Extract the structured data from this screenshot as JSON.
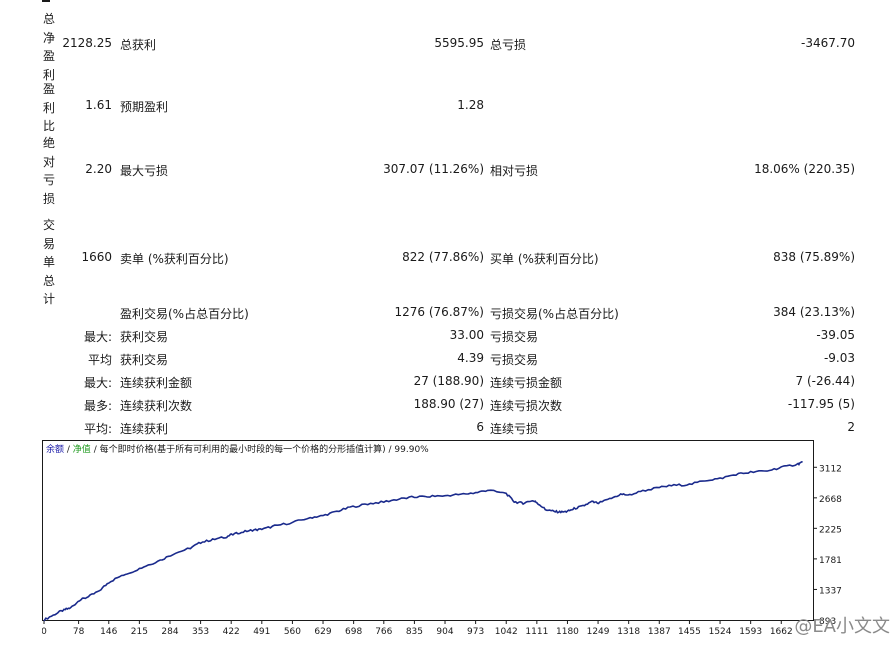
{
  "rows": {
    "total_net_profit": {
      "label": "总净盈利",
      "value": "2128.25",
      "k1": "总获利",
      "v1": "5595.95",
      "k2": "总亏损",
      "v2": "-3467.70"
    },
    "profit_factor": {
      "label": "盈利比",
      "value": "1.61",
      "k1": "预期盈利",
      "v1": "1.28"
    },
    "absolute_drawdown": {
      "label": "绝对亏损",
      "value": "2.20",
      "k1": "最大亏损",
      "v1": "307.07 (11.26%)",
      "k2": "相对亏损",
      "v2": "18.06% (220.35)"
    },
    "total_trades": {
      "label": "交易单总计",
      "value": "1660",
      "k1": "卖单 (%获利百分比)",
      "v1": "822 (77.86%)",
      "k2": "买单 (%获利百分比)",
      "v2": "838 (75.89%)"
    },
    "profit_trades": {
      "k1": "盈利交易(%占总百分比)",
      "v1": "1276 (76.87%)",
      "k2": "亏损交易(%占总百分比)",
      "v2": "384 (23.13%)"
    },
    "largest": {
      "prefix": "最大:",
      "k1": "获利交易",
      "v1": "33.00",
      "k2": "亏损交易",
      "v2": "-39.05"
    },
    "average": {
      "prefix": "平均",
      "k1": "获利交易",
      "v1": "4.39",
      "k2": "亏损交易",
      "v2": "-9.03"
    },
    "max_consec": {
      "prefix": "最大:",
      "k1": "连续获利金额",
      "v1": "27 (188.90)",
      "k2": "连续亏损金额",
      "v2": "7 (-26.44)"
    },
    "maximal_consec": {
      "prefix": "最多:",
      "k1": "连续获利次数",
      "v1": "188.90 (27)",
      "k2": "连续亏损次数",
      "v2": "-117.95 (5)"
    },
    "avg_consec": {
      "prefix": "平均:",
      "k1": "连续获利",
      "v1": "6",
      "k2": "连续亏损",
      "v2": "2"
    }
  },
  "chart_header": {
    "balance_label": "余额",
    "sep1": " / ",
    "equity_label": "净值",
    "sep2": " / ",
    "mode_text": "每个即时价格(基于所有可利用的最小时段的每一个价格的分形插值计算)",
    "sep3": " / ",
    "quality": "99.90%"
  },
  "watermark": "@EA小文文",
  "colors": {
    "balance": "#1a1aa8",
    "equity": "#1f9a1f",
    "line": "#1a2a8c"
  },
  "chart_data": {
    "type": "line",
    "x_ticks": [
      "0",
      "78",
      "146",
      "215",
      "284",
      "353",
      "422",
      "491",
      "560",
      "629",
      "698",
      "766",
      "835",
      "904",
      "973",
      "1042",
      "1111",
      "1180",
      "1249",
      "1318",
      "1387",
      "1455",
      "1524",
      "1593",
      "1662"
    ],
    "y_ticks": [
      "3112",
      "2668",
      "2225",
      "1781",
      "1337",
      "893"
    ],
    "ylim": [
      893,
      3305
    ],
    "xlim": [
      0,
      1720
    ],
    "series": [
      {
        "name": "余额",
        "x": [
          0,
          25,
          45,
          60,
          80,
          100,
          125,
          146,
          175,
          200,
          230,
          262,
          290,
          330,
          353,
          380,
          410,
          422,
          445,
          470,
          491,
          520,
          560,
          600,
          629,
          660,
          690,
          730,
          766,
          800,
          835,
          870,
          904,
          940,
          973,
          1000,
          1042,
          1060,
          1080,
          1100,
          1111,
          1130,
          1150,
          1165,
          1180,
          1195,
          1215,
          1235,
          1250,
          1275,
          1300,
          1320,
          1350,
          1387,
          1420,
          1455,
          1490,
          1524,
          1560,
          1593,
          1630,
          1662,
          1700,
          1710
        ],
        "y": [
          893,
          980,
          1040,
          1070,
          1180,
          1230,
          1320,
          1440,
          1540,
          1600,
          1680,
          1760,
          1850,
          1940,
          2020,
          2060,
          2100,
          2130,
          2170,
          2200,
          2210,
          2260,
          2310,
          2380,
          2410,
          2470,
          2530,
          2580,
          2610,
          2650,
          2680,
          2690,
          2700,
          2720,
          2740,
          2780,
          2730,
          2610,
          2590,
          2630,
          2600,
          2500,
          2470,
          2460,
          2470,
          2510,
          2550,
          2610,
          2590,
          2650,
          2720,
          2710,
          2770,
          2820,
          2850,
          2860,
          2920,
          2950,
          3010,
          3040,
          3060,
          3110,
          3160,
          3190
        ]
      }
    ]
  }
}
